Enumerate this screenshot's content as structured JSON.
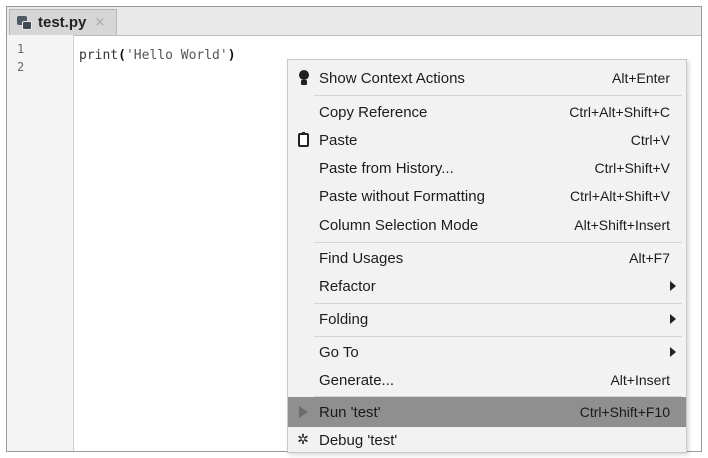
{
  "tab": {
    "label": "test.py",
    "close": "×"
  },
  "gutter": {
    "lines": [
      "1",
      "2"
    ]
  },
  "editor": {
    "func": "print",
    "open": "(",
    "string": "'Hello World'",
    "close": ")"
  },
  "menu": {
    "items": [
      {
        "label": "Show Context Actions",
        "shortcut": "Alt+Enter",
        "icon": "lightbulb-icon"
      },
      {
        "label": "Copy Reference",
        "shortcut": "Ctrl+Alt+Shift+C"
      },
      {
        "label": "Paste",
        "shortcut": "Ctrl+V",
        "icon": "clipboard-icon"
      },
      {
        "label": "Paste from History...",
        "shortcut": "Ctrl+Shift+V"
      },
      {
        "label": "Paste without Formatting",
        "shortcut": "Ctrl+Alt+Shift+V"
      },
      {
        "label": "Column Selection Mode",
        "shortcut": "Alt+Shift+Insert"
      },
      {
        "label": "Find Usages",
        "shortcut": "Alt+F7"
      },
      {
        "label": "Refactor",
        "submenu": true
      },
      {
        "label": "Folding",
        "submenu": true
      },
      {
        "label": "Go To",
        "submenu": true
      },
      {
        "label": "Generate...",
        "shortcut": "Alt+Insert"
      },
      {
        "label": "Run 'test'",
        "shortcut": "Ctrl+Shift+F10",
        "icon": "run-icon",
        "selected": true
      },
      {
        "label": "Debug 'test'",
        "icon": "bug-icon"
      }
    ]
  }
}
